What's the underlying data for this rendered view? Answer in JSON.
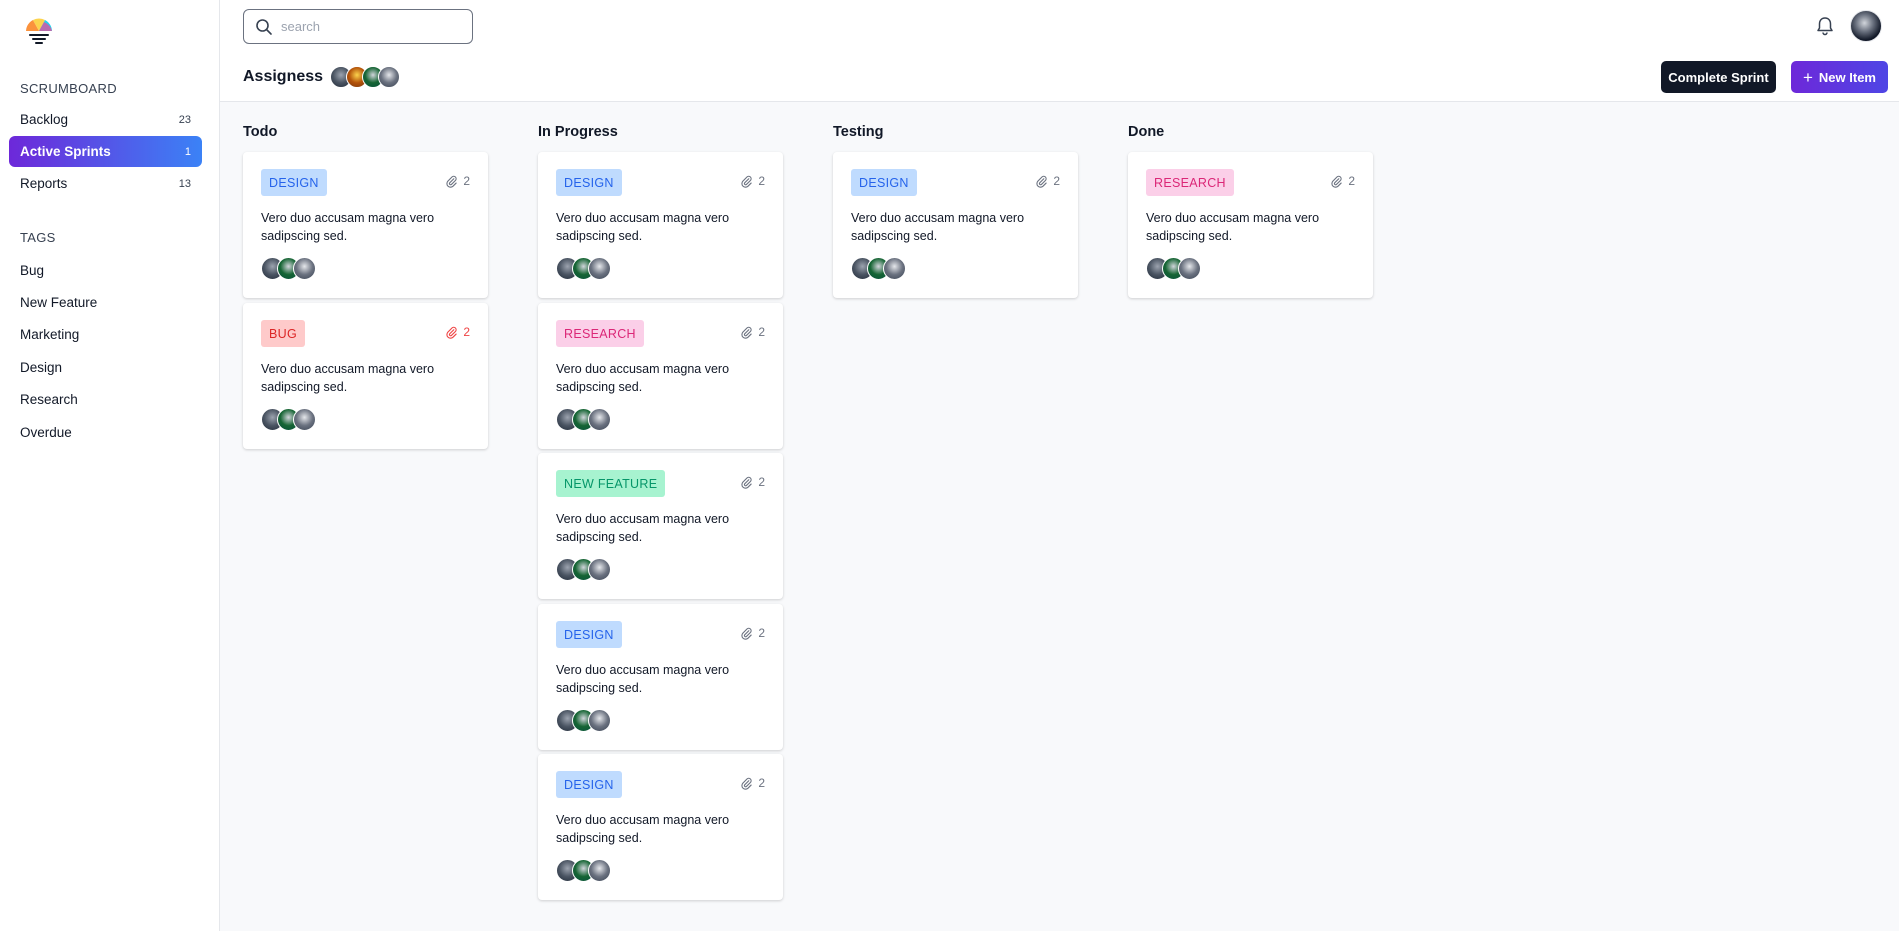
{
  "sidebar": {
    "section_scrumboard": "SCRUMBOARD",
    "nav": [
      {
        "label": "Backlog",
        "count": "23"
      },
      {
        "label": "Active Sprints",
        "count": "1"
      },
      {
        "label": "Reports",
        "count": "13"
      }
    ],
    "section_tags": "TAGS",
    "tags": [
      "Bug",
      "New Feature",
      "Marketing",
      "Design",
      "Research",
      "Overdue"
    ]
  },
  "header": {
    "search_placeholder": "search",
    "assignees_label": "Assigness",
    "complete_sprint_label": "Complete Sprint",
    "new_item_label": "New Item"
  },
  "board": {
    "columns": [
      {
        "title": "Todo",
        "cards": [
          {
            "tag": "DESIGN",
            "attachments": "2",
            "text": "Vero duo accusam magna vero sadipscing sed."
          },
          {
            "tag": "BUG",
            "attachments": "2",
            "text": "Vero duo accusam magna vero sadipscing sed."
          }
        ]
      },
      {
        "title": "In Progress",
        "cards": [
          {
            "tag": "DESIGN",
            "attachments": "2",
            "text": "Vero duo accusam magna vero sadipscing sed."
          },
          {
            "tag": "RESEARCH",
            "attachments": "2",
            "text": "Vero duo accusam magna vero sadipscing sed."
          },
          {
            "tag": "NEW FEATURE",
            "attachments": "2",
            "text": "Vero duo accusam magna vero sadipscing sed."
          },
          {
            "tag": "DESIGN",
            "attachments": "2",
            "text": "Vero duo accusam magna vero sadipscing sed."
          },
          {
            "tag": "DESIGN",
            "attachments": "2",
            "text": "Vero duo accusam magna vero sadipscing sed."
          }
        ]
      },
      {
        "title": "Testing",
        "cards": [
          {
            "tag": "DESIGN",
            "attachments": "2",
            "text": "Vero duo accusam magna vero sadipscing sed."
          }
        ]
      },
      {
        "title": "Done",
        "cards": [
          {
            "tag": "RESEARCH",
            "attachments": "2",
            "text": "Vero duo accusam magna vero sadipscing sed."
          }
        ]
      }
    ]
  },
  "colors": {
    "accent_start": "#6d28d9",
    "accent_end": "#3b82f6",
    "design_tag": "#bfdbfe",
    "bug_tag": "#fecaca",
    "research_tag": "#fbcfe8",
    "new_feature_tag": "#a7f3d0"
  },
  "icons": [
    "logo-icon",
    "search-icon",
    "bell-icon",
    "paperclip-icon",
    "plus-icon"
  ]
}
